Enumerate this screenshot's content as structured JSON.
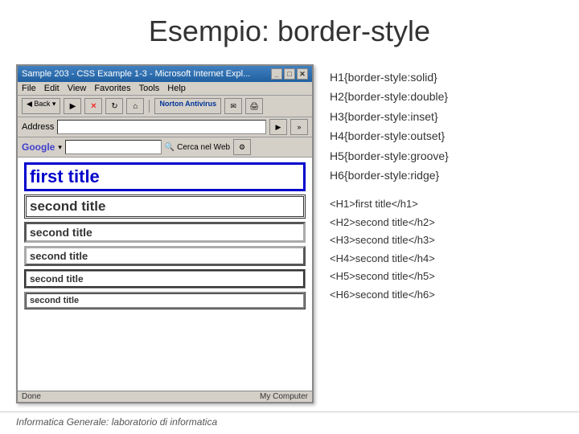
{
  "slide": {
    "title": "Esempio: border-style",
    "footer": "Informatica Generale: laboratorio di informatica"
  },
  "browser": {
    "titlebar": "Sample 203 - CSS Example 1-3 - Microsoft Internet Expl...",
    "menu_items": [
      "File",
      "Edit",
      "View",
      "Favorites",
      "Tools",
      "Help"
    ],
    "address_label": "Address",
    "norton_label": "Norton Antivirus",
    "google_label": "Google",
    "search_placeholder": "Cerca nel Web",
    "status_left": "Done",
    "status_right": "My Computer",
    "h1_text": "first title",
    "h2_text": "second title",
    "h3_text": "second title",
    "h4_text": "second title",
    "h5_text": "second title",
    "h6_text": "second title"
  },
  "css_rules": {
    "lines": [
      "H1{border-style:solid}",
      "H2{border-style:double}",
      "H3{border-style:inset}",
      "H4{border-style:outset}",
      "H5{border-style:groove}",
      "H6{border-style:ridge}"
    ]
  },
  "html_code": {
    "lines": [
      "<H1>first title</h1>",
      "<H2>second title</h2>",
      "<H3>second title</h3>",
      "<H4>second title</h4>",
      "<H5>second title</h5>",
      "<H6>second title</h6>"
    ]
  }
}
